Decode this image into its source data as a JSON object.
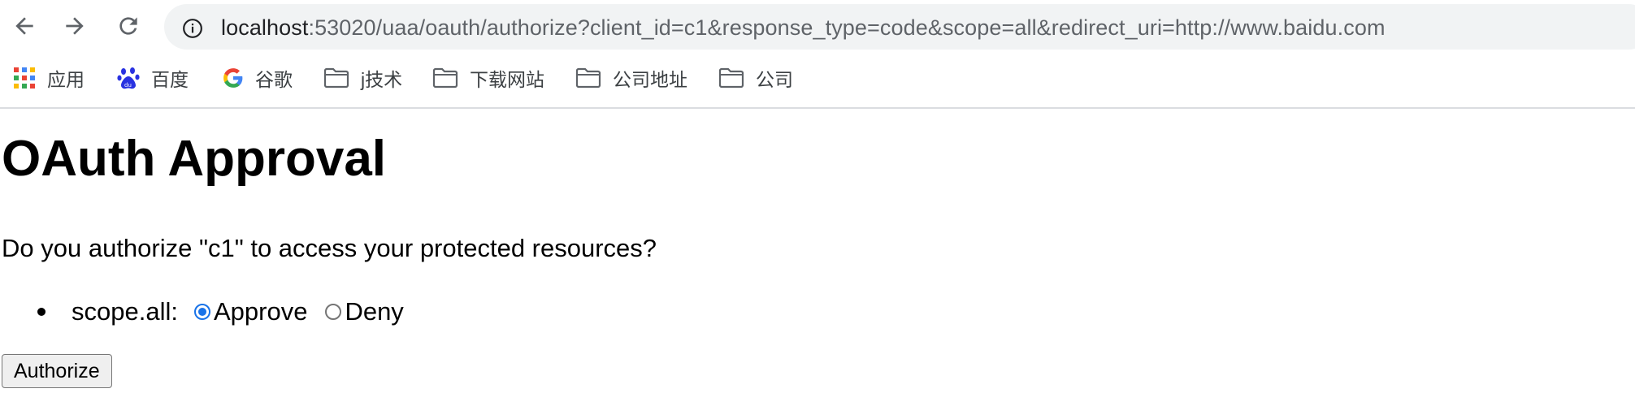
{
  "browser": {
    "url_host": "localhost",
    "url_rest": ":53020/uaa/oauth/authorize?client_id=c1&response_type=code&scope=all&redirect_uri=http://www.baidu.com",
    "bookmarks": [
      {
        "label": "应用",
        "icon": "apps-grid-icon"
      },
      {
        "label": "百度",
        "icon": "baidu-paw-icon"
      },
      {
        "label": "谷歌",
        "icon": "google-g-icon"
      },
      {
        "label": "j技术",
        "icon": "folder-icon"
      },
      {
        "label": "下载网站",
        "icon": "folder-icon"
      },
      {
        "label": "公司地址",
        "icon": "folder-icon"
      },
      {
        "label": "公司",
        "icon": "folder-icon"
      }
    ]
  },
  "page": {
    "title": "OAuth Approval",
    "question": "Do you authorize \"c1\" to access your protected resources?",
    "scopes": [
      {
        "label": "scope.all:",
        "approve_label": "Approve",
        "deny_label": "Deny",
        "selected": "Approve"
      }
    ],
    "submit_label": "Authorize"
  },
  "colors": {
    "accent": "#1a73e8",
    "omnibox_bg": "#f1f3f4"
  }
}
